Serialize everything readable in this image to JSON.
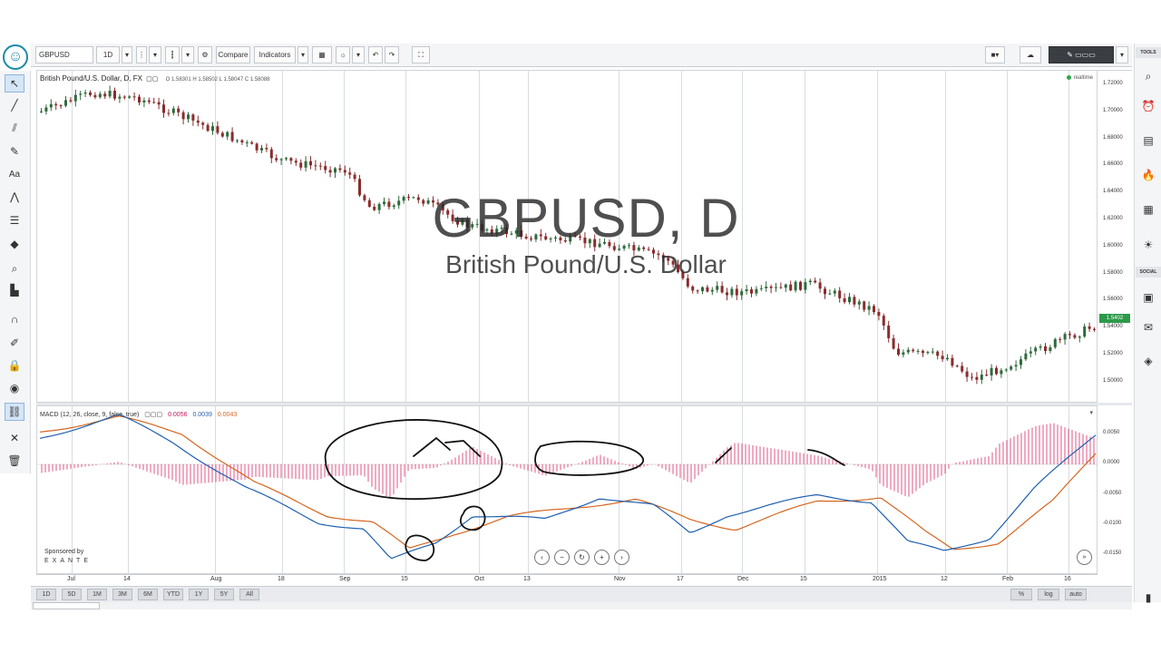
{
  "toolbar": {
    "symbol": "GBPUSD",
    "interval": "1D",
    "compare_label": "Compare",
    "indicators_label": "Indicators"
  },
  "chart": {
    "legend_title": "British Pound/U.S. Dollar, D, FX",
    "ohlc": "O 1.58301 H 1.58502 L 1.58047 C 1.58088",
    "realtime_label": "realtime",
    "watermark_symbol": "GBPUSD, D",
    "watermark_description": "British Pound/U.S. Dollar",
    "last_price": "1.5402"
  },
  "macd": {
    "legend": "MACD (12, 26, close, 9, false, true)",
    "hist_value": "0.0056",
    "macd_value": "0.0039",
    "signal_value": "0.0043"
  },
  "sponsor": {
    "label": "Sponsored by",
    "brand": "EXANTE"
  },
  "right_tools": {
    "tools_label": "TOOLS",
    "social_label": "SOCIAL"
  },
  "bottom_bar": {
    "ranges": [
      "1D",
      "5D",
      "1M",
      "3M",
      "6M",
      "YTD",
      "1Y",
      "5Y",
      "All"
    ],
    "right": [
      "%",
      "log",
      "auto"
    ]
  },
  "price_axis": {
    "ticks": [
      "1.72000",
      "1.70000",
      "1.68000",
      "1.66000",
      "1.64000",
      "1.62000",
      "1.60000",
      "1.58000",
      "1.56000",
      "1.54000",
      "1.52000",
      "1.50000"
    ]
  },
  "macd_axis": {
    "ticks": [
      "0.0050",
      "0.0000",
      "-0.0050",
      "-0.0100",
      "-0.0150"
    ]
  },
  "time_axis": {
    "labels": [
      "Jul",
      "14",
      "Aug",
      "18",
      "Sep",
      "15",
      "Oct",
      "13",
      "Nov",
      "17",
      "Dec",
      "15",
      "2015",
      "12",
      "Feb",
      "16"
    ]
  },
  "colors": {
    "up": "#2f6b3d",
    "down": "#8b2c2c",
    "macd_line": "#1e5fb0",
    "signal_line": "#d4651e",
    "histogram": "#d81b60"
  }
}
